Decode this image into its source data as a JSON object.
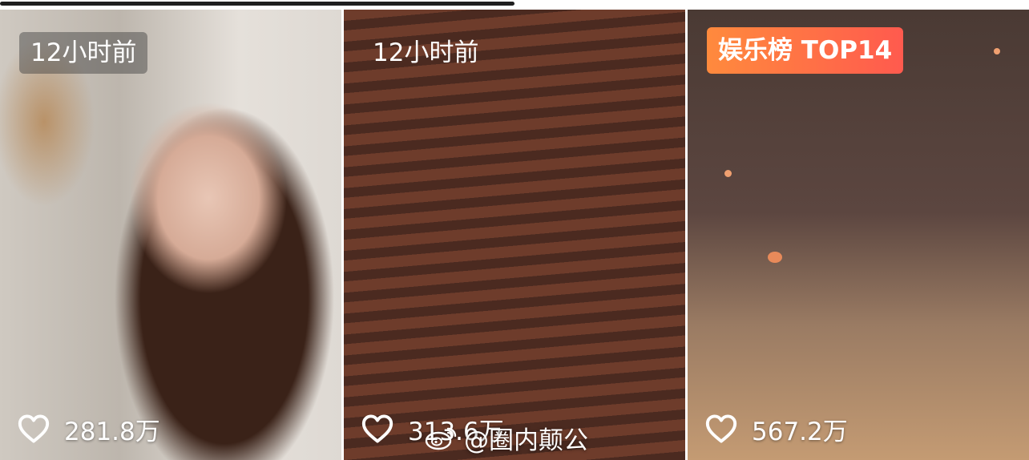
{
  "progress": {
    "fraction": 0.5
  },
  "cards": [
    {
      "time_label": "12小时前",
      "likes": "281.8万",
      "heart_icon": "heart-outline-icon"
    },
    {
      "time_label": "12小时前",
      "likes": "313.6万",
      "heart_icon": "heart-outline-icon"
    },
    {
      "rank_label": "娱乐榜 TOP14",
      "likes": "567.2万",
      "heart_icon": "heart-outline-icon",
      "rank_color_start": "#ff8a3d",
      "rank_color_end": "#ff5a4e"
    }
  ],
  "watermark": {
    "text": "@圈内颠公",
    "icon": "weibo-icon"
  }
}
